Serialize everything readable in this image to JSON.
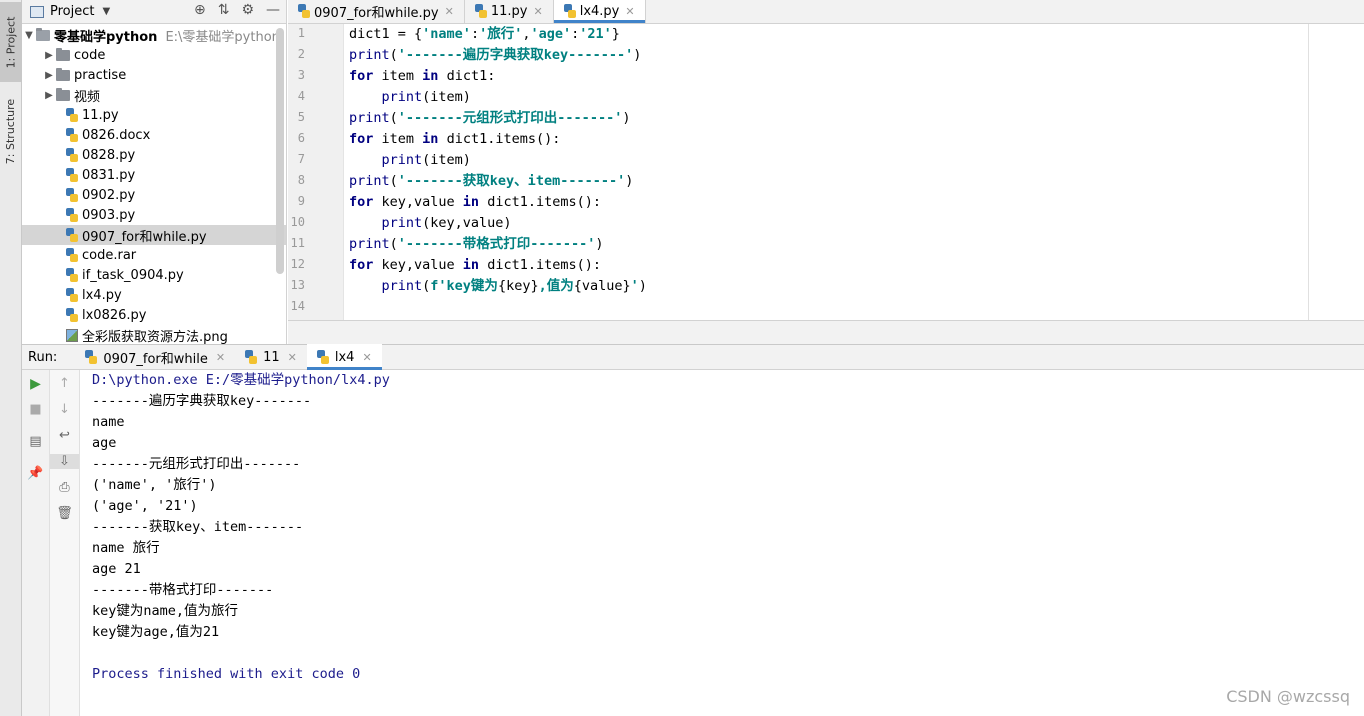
{
  "left_strip": {
    "project_tab": "1: Project",
    "structure_tab": "7: Structure"
  },
  "project_panel": {
    "title": "Project",
    "root": {
      "name": "零基础学python",
      "path": "E:\\零基础学python"
    },
    "folders": [
      "code",
      "practise",
      "视频"
    ],
    "files": [
      {
        "name": "11.py",
        "type": "py"
      },
      {
        "name": "0826.docx",
        "type": "doc"
      },
      {
        "name": "0828.py",
        "type": "py"
      },
      {
        "name": "0831.py",
        "type": "py"
      },
      {
        "name": "0902.py",
        "type": "py"
      },
      {
        "name": "0903.py",
        "type": "py"
      },
      {
        "name": "0907_for和while.py",
        "type": "py",
        "selected": true
      },
      {
        "name": "code.rar",
        "type": "py"
      },
      {
        "name": "if_task_0904.py",
        "type": "py"
      },
      {
        "name": "lx4.py",
        "type": "py"
      },
      {
        "name": "lx0826.py",
        "type": "py"
      },
      {
        "name": "全彩版获取资源方法.png",
        "type": "png"
      }
    ]
  },
  "editor": {
    "tabs": [
      {
        "label": "0907_for和while.py",
        "active": false
      },
      {
        "label": "11.py",
        "active": false
      },
      {
        "label": "lx4.py",
        "active": true
      }
    ],
    "line_numbers": [
      "1",
      "2",
      "3",
      "4",
      "5",
      "6",
      "7",
      "8",
      "9",
      "10",
      "11",
      "12",
      "13",
      "14"
    ]
  },
  "run": {
    "label": "Run:",
    "tabs": [
      {
        "label": "0907_for和while",
        "active": false
      },
      {
        "label": "11",
        "active": false
      },
      {
        "label": "lx4",
        "active": true
      }
    ],
    "output": [
      {
        "text": "D:\\python.exe E:/零基础学python/lx4.py",
        "sys": true
      },
      {
        "text": "-------遍历字典获取key-------",
        "sys": false
      },
      {
        "text": "name",
        "sys": false
      },
      {
        "text": "age",
        "sys": false
      },
      {
        "text": "-------元组形式打印出-------",
        "sys": false
      },
      {
        "text": "('name', '旅行')",
        "sys": false
      },
      {
        "text": "('age', '21')",
        "sys": false
      },
      {
        "text": "-------获取key、item-------",
        "sys": false
      },
      {
        "text": "name 旅行",
        "sys": false
      },
      {
        "text": "age 21",
        "sys": false
      },
      {
        "text": "-------带格式打印-------",
        "sys": false
      },
      {
        "text": "key键为name,值为旅行",
        "sys": false
      },
      {
        "text": "key键为age,值为21",
        "sys": false
      },
      {
        "text": "",
        "sys": false
      },
      {
        "text": "Process finished with exit code 0",
        "sys": true
      }
    ]
  },
  "code": {
    "l1": [
      "dict1 = {",
      "'name'",
      ":",
      "'旅行'",
      ",",
      "'age'",
      ":",
      "'21'",
      "}"
    ],
    "l2": [
      "print",
      "(",
      "'-------遍历字典获取key-------'",
      ")"
    ],
    "l3": [
      "for",
      " item ",
      "in",
      " dict1:"
    ],
    "l4": [
      "    ",
      "print",
      "(item)"
    ],
    "l5": [
      "print",
      "(",
      "'-------元组形式打印出-------'",
      ")"
    ],
    "l6": [
      "for",
      " item ",
      "in",
      " dict1.items():"
    ],
    "l7": [
      "    ",
      "print",
      "(item)"
    ],
    "l8": [
      "print",
      "(",
      "'-------获取key、item-------'",
      ")"
    ],
    "l9": [
      "for",
      " key,value ",
      "in",
      " dict1.items():"
    ],
    "l10": [
      "    ",
      "print",
      "(key,value)"
    ],
    "l11": [
      "print",
      "(",
      "'-------带格式打印-------'",
      ")"
    ],
    "l12": [
      "for",
      " key,value ",
      "in",
      " dict1.items():"
    ],
    "l13": [
      "    ",
      "print",
      "(",
      "f'key键为",
      "{key}",
      ",值为",
      "{value}",
      "'",
      ")"
    ]
  },
  "watermark": "CSDN @wzcssq"
}
